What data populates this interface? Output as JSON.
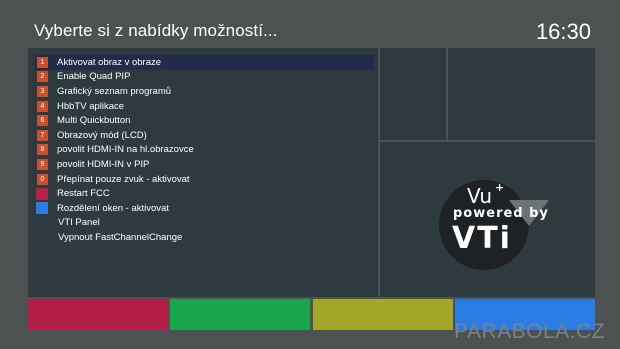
{
  "header": {
    "title": "Vyberte si z nabídky možností...",
    "clock": "16:30"
  },
  "menu": {
    "items": [
      {
        "badge": "1",
        "label": "Aktivovat obraz v obraze",
        "selected": true
      },
      {
        "badge": "2",
        "label": "Enable Quad PIP"
      },
      {
        "badge": "3",
        "label": "Grafický seznam programů"
      },
      {
        "badge": "4",
        "label": "HbbTV aplikace"
      },
      {
        "badge": "6",
        "label": "Multi Quickbutton"
      },
      {
        "badge": "7",
        "label": "Obrazový mód (LCD)"
      },
      {
        "badge": "8",
        "label": "povolit HDMI-IN na hl.obrazovce"
      },
      {
        "badge": "9",
        "label": "povolit HDMI-IN v PIP"
      },
      {
        "badge": "0",
        "label": "Přepínat pouze zvuk - aktivovat"
      },
      {
        "badge": "",
        "badge_color": "#b5234a",
        "label": "Restart FCC"
      },
      {
        "badge": "",
        "badge_color": "#2b7be0",
        "label": "Rozdělení oken - aktivovat"
      },
      {
        "badge": "",
        "label": "VTI Panel"
      },
      {
        "badge": "",
        "label": "Vypnout FastChannelChange"
      }
    ]
  },
  "logo": {
    "brand_top": "Vu",
    "brand_plus": "+",
    "powered_by": "powered by",
    "brand_main": "VTi"
  },
  "color_buttons": [
    {
      "name": "red-button",
      "color": "#b41c48"
    },
    {
      "name": "green-button",
      "color": "#1aa54a"
    },
    {
      "name": "yellow-button",
      "color": "#a2a72a"
    },
    {
      "name": "blue-button",
      "color": "#2b7de6"
    }
  ],
  "colors": {
    "background": "#4c5152",
    "panel": "#2e3a40",
    "number_badge": "#c8512e",
    "selected_row": "#222c4a"
  },
  "watermark": "PARABOLA.CZ"
}
